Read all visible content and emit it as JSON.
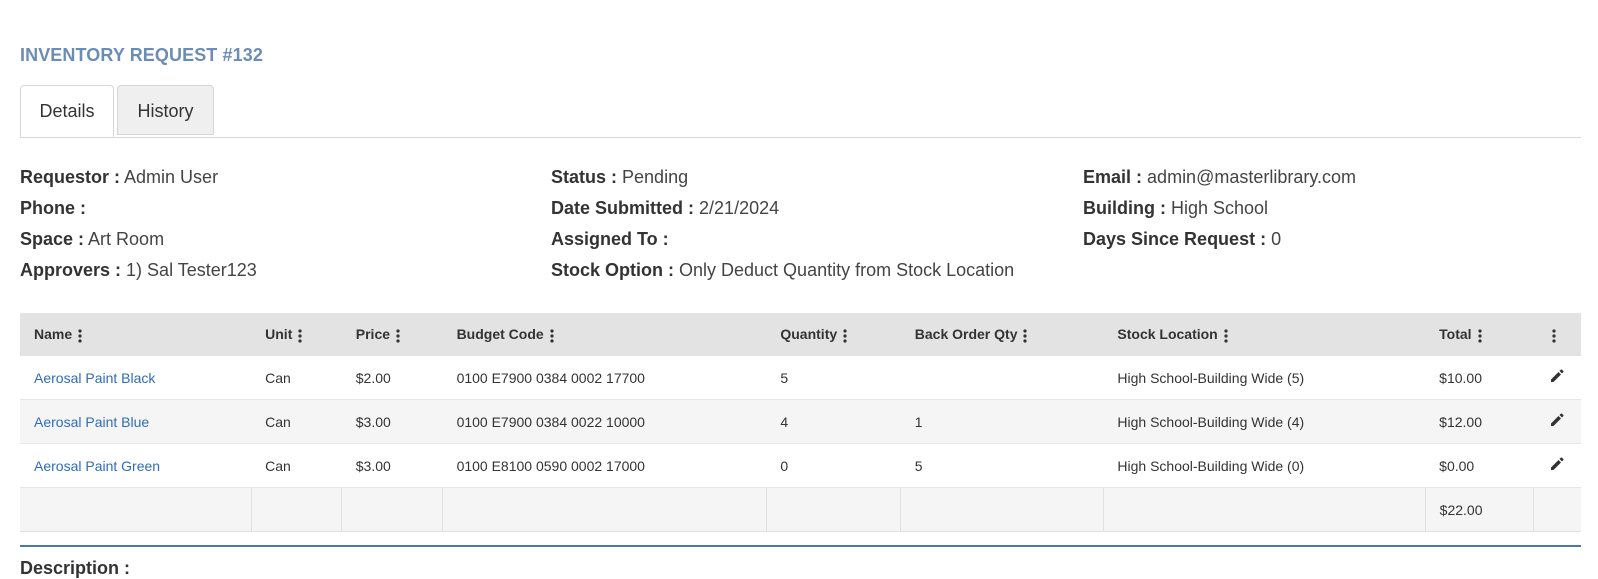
{
  "page": {
    "title": "INVENTORY REQUEST #132"
  },
  "tabs": [
    {
      "label": "Details",
      "active": true
    },
    {
      "label": "History",
      "active": false
    }
  ],
  "info": {
    "requestor": {
      "label": "Requestor :",
      "value": "Admin User"
    },
    "phone": {
      "label": "Phone :",
      "value": ""
    },
    "space": {
      "label": "Space :",
      "value": "Art Room"
    },
    "approvers": {
      "label": "Approvers :",
      "value": "1) Sal Tester123"
    },
    "status": {
      "label": "Status :",
      "value": "Pending"
    },
    "date_submitted": {
      "label": "Date Submitted :",
      "value": "2/21/2024"
    },
    "assigned_to": {
      "label": "Assigned To :",
      "value": ""
    },
    "stock_option": {
      "label": "Stock Option :",
      "value": "Only Deduct Quantity from Stock Location"
    },
    "email": {
      "label": "Email :",
      "value": "admin@masterlibrary.com"
    },
    "building": {
      "label": "Building :",
      "value": "High School"
    },
    "days_since": {
      "label": "Days Since Request :",
      "value": "0"
    }
  },
  "table": {
    "columns": [
      "Name",
      "Unit",
      "Price",
      "Budget Code",
      "Quantity",
      "Back Order Qty",
      "Stock Location",
      "Total"
    ],
    "rows": [
      {
        "name": "Aerosal Paint Black",
        "unit": "Can",
        "price": "$2.00",
        "budget_code": "0100 E7900 0384 0002 17700",
        "quantity": "5",
        "back_order": "",
        "stock_location": "High School-Building Wide (5)",
        "total": "$10.00"
      },
      {
        "name": "Aerosal Paint Blue",
        "unit": "Can",
        "price": "$3.00",
        "budget_code": "0100 E7900 0384 0022 10000",
        "quantity": "4",
        "back_order": "1",
        "stock_location": "High School-Building Wide (4)",
        "total": "$12.00"
      },
      {
        "name": "Aerosal Paint Green",
        "unit": "Can",
        "price": "$3.00",
        "budget_code": "0100 E8100 0590 0002 17000",
        "quantity": "0",
        "back_order": "5",
        "stock_location": "High School-Building Wide (0)",
        "total": "$0.00"
      }
    ],
    "grand_total": "$22.00"
  },
  "description": {
    "label": "Description :"
  },
  "colors": {
    "title": "#6b8db5",
    "link": "#2f6db8",
    "header_bg": "#e3e3e3",
    "divider": "#4d78a6"
  },
  "icons": {
    "column_menu": "kebab-vertical-icon",
    "row_edit": "pencil-icon"
  }
}
